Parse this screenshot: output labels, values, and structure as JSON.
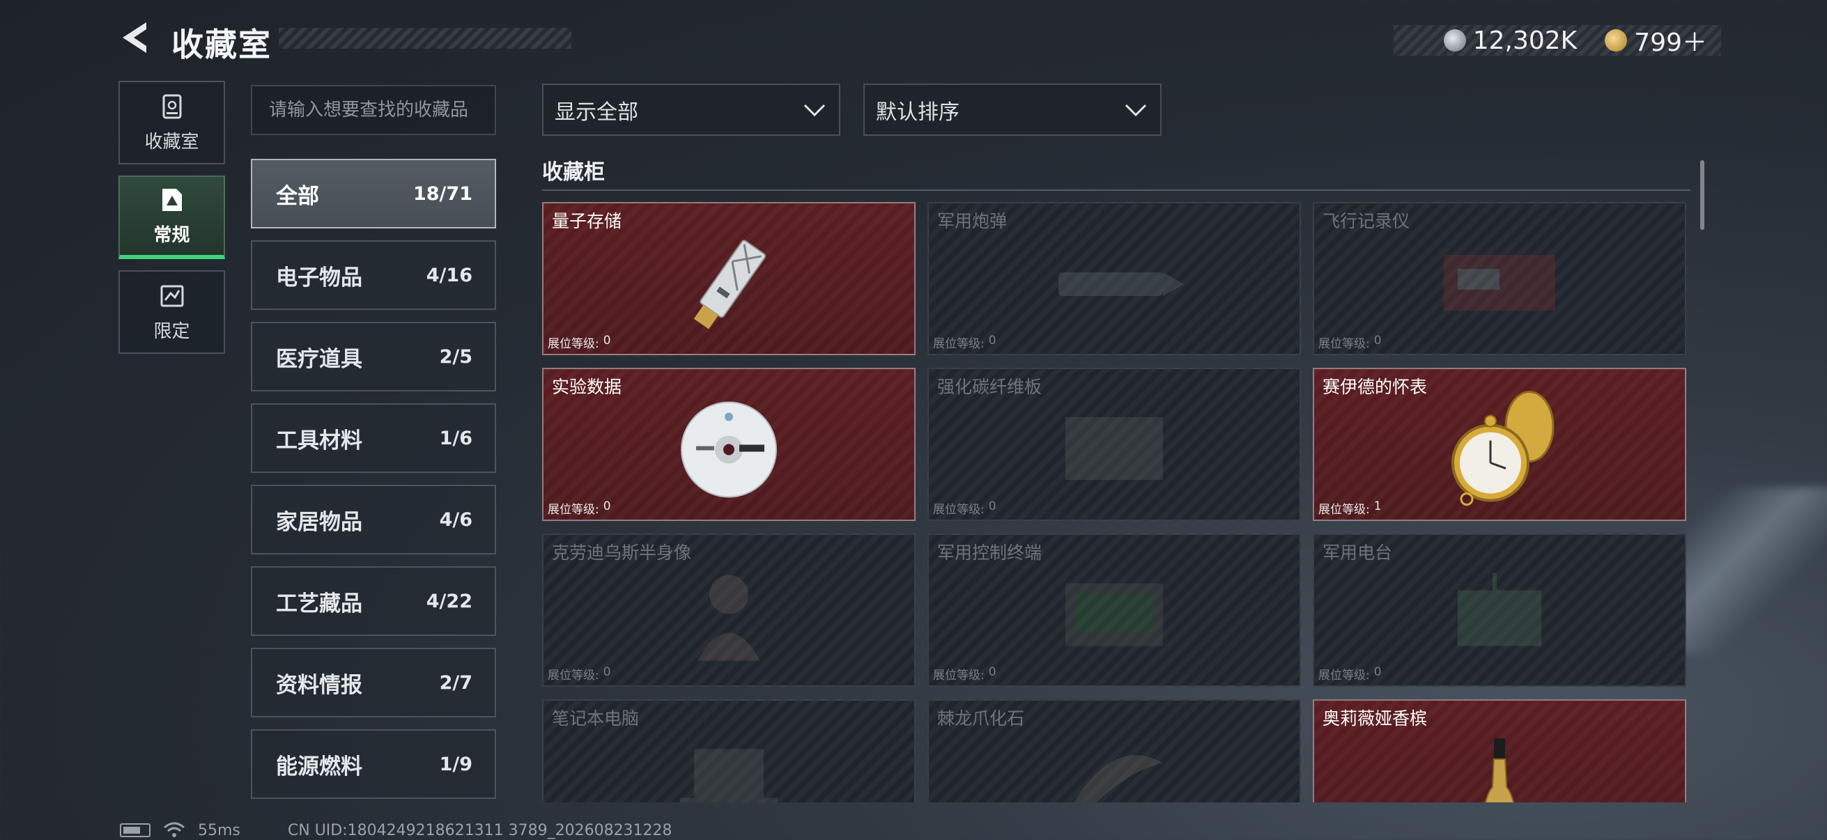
{
  "header": {
    "title": "收藏室",
    "currency": [
      {
        "icon": "silver-coin-icon",
        "value": "12,302K"
      },
      {
        "icon": "gold-coin-icon",
        "value": "799＋"
      }
    ]
  },
  "nav": [
    {
      "label": "收藏室",
      "icon": "collection-room-icon",
      "active": false
    },
    {
      "label": "常规",
      "icon": "regular-icon",
      "active": true
    },
    {
      "label": "限定",
      "icon": "limited-icon",
      "active": false
    }
  ],
  "search": {
    "placeholder": "请输入想要查找的收藏品"
  },
  "categories": [
    {
      "name": "全部",
      "count": "18/71",
      "active": true
    },
    {
      "name": "电子物品",
      "count": "4/16"
    },
    {
      "name": "医疗道具",
      "count": "2/5"
    },
    {
      "name": "工具材料",
      "count": "1/6"
    },
    {
      "name": "家居物品",
      "count": "4/6"
    },
    {
      "name": "工艺藏品",
      "count": "4/22"
    },
    {
      "name": "资料情报",
      "count": "2/7"
    },
    {
      "name": "能源燃料",
      "count": "1/9"
    }
  ],
  "filters": {
    "display": "显示全部",
    "sort": "默认排序"
  },
  "cabinet": {
    "title": "收藏柜",
    "level_label": "展位等级:",
    "items": [
      {
        "name": "量子存储",
        "level": "0",
        "owned": true,
        "icon": "usb-drive-icon"
      },
      {
        "name": "军用炮弹",
        "level": "0",
        "owned": false,
        "icon": "artillery-shell-icon"
      },
      {
        "name": "飞行记录仪",
        "level": "0",
        "owned": false,
        "icon": "flight-recorder-icon"
      },
      {
        "name": "实验数据",
        "level": "0",
        "owned": true,
        "icon": "data-disc-icon"
      },
      {
        "name": "强化碳纤维板",
        "level": "0",
        "owned": false,
        "icon": "carbon-plate-icon"
      },
      {
        "name": "赛伊德的怀表",
        "level": "1",
        "owned": true,
        "icon": "pocket-watch-icon"
      },
      {
        "name": "克劳迪乌斯半身像",
        "level": "0",
        "owned": false,
        "icon": "bust-icon"
      },
      {
        "name": "军用控制终端",
        "level": "0",
        "owned": false,
        "icon": "control-terminal-icon"
      },
      {
        "name": "军用电台",
        "level": "0",
        "owned": false,
        "icon": "military-radio-icon"
      },
      {
        "name": "笔记本电脑",
        "level": "",
        "owned": false,
        "icon": "laptop-icon"
      },
      {
        "name": "棘龙爪化石",
        "level": "",
        "owned": false,
        "icon": "claw-fossil-icon"
      },
      {
        "name": "奥莉薇娅香槟",
        "level": "",
        "owned": true,
        "icon": "champagne-icon"
      }
    ]
  },
  "footer": {
    "ping": "55ms",
    "uid": "CN UID:1804249218621311 3789_202608231228"
  },
  "colors": {
    "accent_green": "#3fd37c",
    "owned_card": "#5a1d21",
    "background": "#252b33"
  }
}
